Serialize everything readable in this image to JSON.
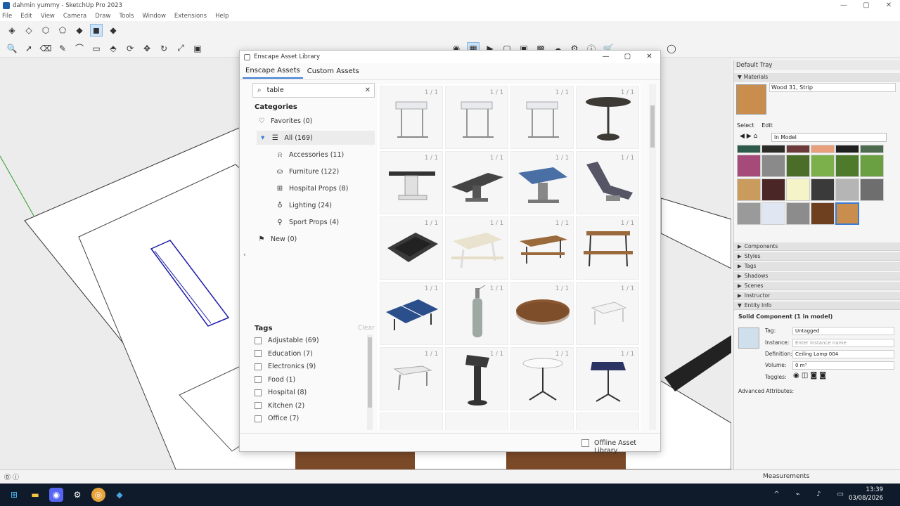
{
  "window": {
    "title": "dahmin yummy - SketchUp Pro 2023"
  },
  "menu": [
    "File",
    "Edit",
    "View",
    "Camera",
    "Draw",
    "Tools",
    "Window",
    "Extensions",
    "Help"
  ],
  "dialog": {
    "title": "Enscape Asset Library",
    "tabs": [
      "Enscape Assets",
      "Custom Assets"
    ],
    "search_value": "table",
    "categories_heading": "Categories",
    "categories": [
      {
        "label": "Favorites (0)",
        "icon": "heart-icon",
        "indent": 0
      },
      {
        "label": "All (169)",
        "icon": "list-icon",
        "indent": 0,
        "selected": true
      },
      {
        "label": "Accessories (11)",
        "icon": "bell-icon",
        "indent": 1
      },
      {
        "label": "Furniture (122)",
        "icon": "sofa-icon",
        "indent": 1
      },
      {
        "label": "Hospital Props (8)",
        "icon": "medical-kit-icon",
        "indent": 1
      },
      {
        "label": "Lighting (24)",
        "icon": "lightbulb-icon",
        "indent": 1
      },
      {
        "label": "Sport Props (4)",
        "icon": "whistle-icon",
        "indent": 1
      },
      {
        "label": "New (0)",
        "icon": "flag-icon",
        "indent": 0
      }
    ],
    "tags_heading": "Tags",
    "clear_label": "Clear",
    "tags": [
      "Adjustable (69)",
      "Education (7)",
      "Electronics (9)",
      "Food (1)",
      "Hospital (8)",
      "Kitchen (2)",
      "Office (7)"
    ],
    "asset_count_label": "1 / 1",
    "assets": [
      "overbed-table",
      "overbed-table",
      "overbed-table",
      "round-pedestal-table",
      "surgical-table",
      "operating-table",
      "exam-table-blue",
      "exam-chair",
      "drawing-tablet",
      "picnic-table",
      "picnic-table-wood",
      "picnic-bench-set",
      "ping-pong-table",
      "oxygen-tank",
      "oval-wood-table",
      "small-white-table",
      "small-desk",
      "lectern",
      "round-cafe-table",
      "square-bistro-table"
    ],
    "offline_label": "Offline Asset Library"
  },
  "tray": {
    "title": "Default Tray",
    "materials_label": "Materials",
    "material_name": "Wood 31, Strip",
    "select_label": "Select",
    "edit_label": "Edit",
    "in_model": "In Model",
    "sections": [
      "Components",
      "Styles",
      "Tags",
      "Shadows",
      "Scenes",
      "Instructor",
      "Entity Info"
    ],
    "entity_title": "Solid Component (1 in model)",
    "tag_label": "Tag:",
    "tag_value": "Untagged",
    "instance_label": "Instance:",
    "instance_placeholder": "Enter instance name",
    "definition_label": "Definition:",
    "definition_value": "Ceiling Lamp 004",
    "volume_label": "Volume:",
    "volume_value": "0 m³",
    "toggles_label": "Toggles:",
    "advanced_label": "Advanced Attributes:"
  },
  "status": {
    "measurements": "Measurements"
  },
  "taskbar": {
    "time": "13:39",
    "date": "03/08/2026"
  }
}
